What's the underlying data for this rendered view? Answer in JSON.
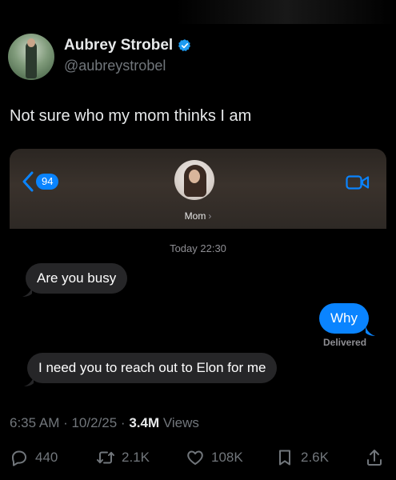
{
  "tweet": {
    "author_name": "Aubrey Strobel",
    "handle": "@aubreystrobel",
    "text": "Not sure who my mom thinks I am",
    "time": "6:35 AM · 10/2/25 · ",
    "views_count": "3.4M",
    "views_label": " Views"
  },
  "imessage": {
    "back_badge": "94",
    "contact_name": "Mom",
    "contact_chevron": "›",
    "timestamp": "Today 22:30",
    "messages": [
      {
        "direction": "in",
        "text": "Are you busy"
      },
      {
        "direction": "out",
        "text": "Why"
      },
      {
        "direction": "in",
        "text": "I need you to reach out to Elon for me"
      }
    ],
    "delivered_label": "Delivered"
  },
  "actions": {
    "replies": "440",
    "reposts": "2.1K",
    "likes": "108K",
    "bookmarks": "2.6K"
  },
  "icons": {
    "verified": "verified-badge-icon",
    "reply": "reply-icon",
    "repost": "repost-icon",
    "like": "heart-icon",
    "bookmark": "bookmark-icon",
    "share": "share-icon",
    "back": "chevron-left-icon",
    "video": "video-camera-icon"
  },
  "colors": {
    "background": "#000000",
    "verified_blue": "#1d9bf0",
    "imessage_blue": "#0a84ff",
    "incoming_bubble": "#262628",
    "muted_text": "#71767b"
  }
}
